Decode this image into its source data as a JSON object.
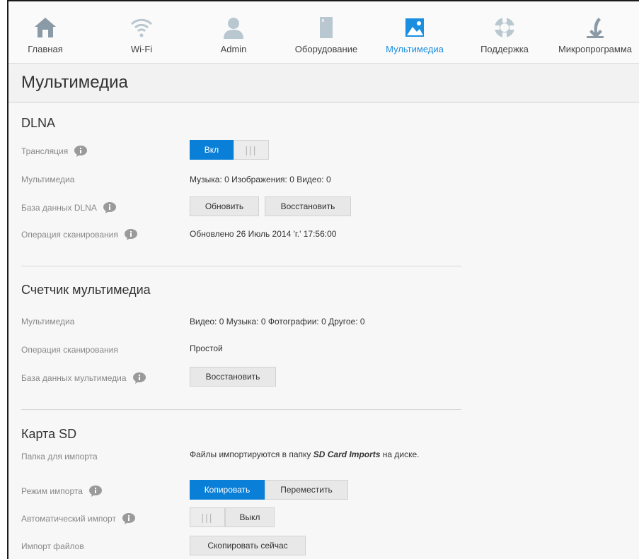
{
  "nav": {
    "items": [
      {
        "label": "Главная",
        "icon": "home-icon"
      },
      {
        "label": "Wi-Fi",
        "icon": "wifi-icon"
      },
      {
        "label": "Admin",
        "icon": "user-icon"
      },
      {
        "label": "Оборудование",
        "icon": "drive-icon"
      },
      {
        "label": "Мультимедиа",
        "icon": "image-icon",
        "active": true
      },
      {
        "label": "Поддержка",
        "icon": "lifebuoy-icon"
      },
      {
        "label": "Микропрограмма",
        "icon": "firmware-download-icon"
      }
    ]
  },
  "page": {
    "title": "Мультимедиа"
  },
  "dlna": {
    "title": "DLNA",
    "streaming_label": "Трансляция",
    "streaming_on": "Вкл",
    "streaming_grip": "|||",
    "media_label": "Мультимедиа",
    "media_value": "Музыка: 0   Изображения: 0   Видео: 0",
    "db_label": "База данных DLNA",
    "refresh_btn": "Обновить",
    "restore_btn": "Восстановить",
    "scan_label": "Операция сканирования",
    "scan_value": "Обновлено 26 Июль 2014 'г.' 17:56:00"
  },
  "counter": {
    "title": "Счетчик мультимедиа",
    "media_label": "Мультимедиа",
    "media_value": "Видео: 0   Музыка: 0   Фотографии: 0   Другое: 0",
    "scan_label": "Операция сканирования",
    "scan_value": "Простой",
    "db_label": "База данных мультимедиа",
    "restore_btn": "Восстановить"
  },
  "sd": {
    "title": "Карта SD",
    "folder_label": "Папка для импорта",
    "folder_prefix": "Файлы импортируются в папку ",
    "folder_name": "SD Card Imports",
    "folder_suffix": " на диске.",
    "mode_label": "Режим импорта",
    "copy_btn": "Копировать",
    "move_btn": "Переместить",
    "auto_label": "Автоматический импорт",
    "auto_grip": "|||",
    "auto_off": "Выкл",
    "import_label": "Импорт файлов",
    "copy_now_btn": "Скопировать сейчас"
  },
  "colors": {
    "accent": "#0a7fd8",
    "active_nav": "#1a8fe0",
    "icon_gray": "#8a9aa6"
  }
}
